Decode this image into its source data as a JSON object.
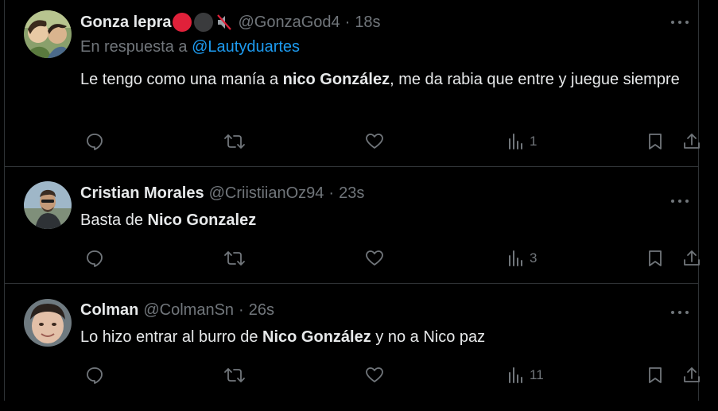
{
  "tweets": [
    {
      "name": "Gonza lepra",
      "handle": "@GonzaGod4",
      "separator": "·",
      "time": "18s",
      "reply_prefix": "En respuesta a",
      "reply_mention": "@Lautyduartes",
      "text_before": "Le tengo como una manía a ",
      "text_bold": "nico González",
      "text_after": ", me da rabia que entre y juegue siempre",
      "views": "1",
      "name_badges": [
        "red-circle",
        "black-circle",
        "muted-speaker"
      ]
    },
    {
      "name": "Cristian Morales",
      "handle": "@CriistiianOz94",
      "separator": "·",
      "time": "23s",
      "text_before": "Basta de ",
      "text_bold": "Nico Gonzalez",
      "text_after": "",
      "views": "3"
    },
    {
      "name": "Colman",
      "handle": "@ColmanSn",
      "separator": "·",
      "time": "26s",
      "text_before": "Lo hizo entrar al burro de ",
      "text_bold": "Nico González",
      "text_after": " y no a Nico paz",
      "views": "11"
    }
  ],
  "colors": {
    "background": "#000000",
    "text": "#e7e9ea",
    "muted": "#71767b",
    "link": "#1d9bf0",
    "divider": "#2f3336"
  },
  "icons": [
    "reply-icon",
    "retweet-icon",
    "like-icon",
    "views-icon",
    "bookmark-icon",
    "share-icon",
    "more-icon"
  ]
}
